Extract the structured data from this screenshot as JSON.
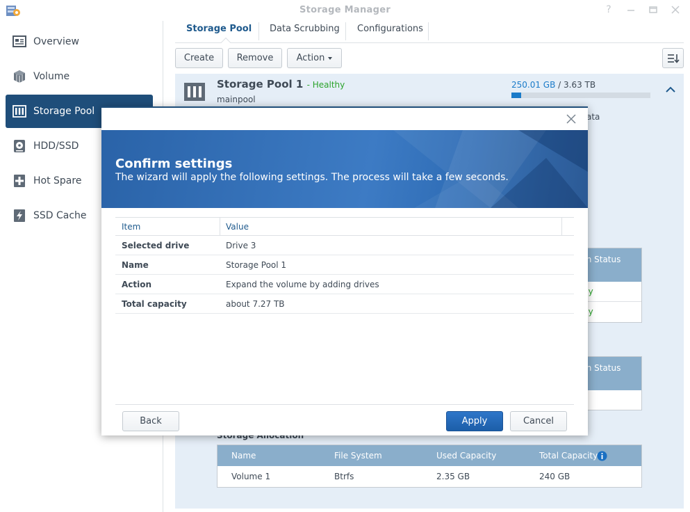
{
  "window": {
    "title": "Storage Manager"
  },
  "sidebar": {
    "items": [
      {
        "label": "Overview",
        "icon": "overview-icon"
      },
      {
        "label": "Volume",
        "icon": "volume-icon"
      },
      {
        "label": "Storage Pool",
        "icon": "storage-pool-icon",
        "active": true
      },
      {
        "label": "HDD/SSD",
        "icon": "hdd-icon"
      },
      {
        "label": "Hot Spare",
        "icon": "hot-spare-icon"
      },
      {
        "label": "SSD Cache",
        "icon": "ssd-cache-icon"
      }
    ]
  },
  "tabs": [
    {
      "label": "Storage Pool",
      "active": true
    },
    {
      "label": "Data Scrubbing"
    },
    {
      "label": "Configurations"
    }
  ],
  "toolbar": {
    "create": "Create",
    "remove": "Remove",
    "action": "Action"
  },
  "pool": {
    "name": "Storage Pool 1",
    "status": "- Healthy",
    "description": "mainpool",
    "used": "250.01 GB",
    "capacity_rest": " / 3.63 TB",
    "used_fraction": 0.07,
    "peek_ata": "ata",
    "peek_status1": "th Status",
    "peek_healthy1": "hy",
    "peek_healthy2": "hy",
    "peek_status2": "th Status"
  },
  "allocation": {
    "title": "Storage Allocation",
    "columns": [
      "Name",
      "File System",
      "Used Capacity",
      "Total Capacity"
    ],
    "rows": [
      [
        "Volume 1",
        "Btrfs",
        "2.35 GB",
        "240 GB"
      ]
    ]
  },
  "modal": {
    "heading": "Confirm settings",
    "subheading": "The wizard will apply the following settings. The process will take a few seconds.",
    "table": {
      "columns": [
        "Item",
        "Value"
      ],
      "rows": [
        [
          "Selected drive",
          "Drive 3"
        ],
        [
          "Name",
          "Storage Pool 1"
        ],
        [
          "Action",
          "Expand the volume by adding drives"
        ],
        [
          "Total capacity",
          "about 7.27 TB"
        ]
      ]
    },
    "back": "Back",
    "apply": "Apply",
    "cancel": "Cancel"
  },
  "colors": {
    "accent": "#1f4e7a",
    "healthy": "#2ba32b",
    "link": "#1a7bc9"
  }
}
